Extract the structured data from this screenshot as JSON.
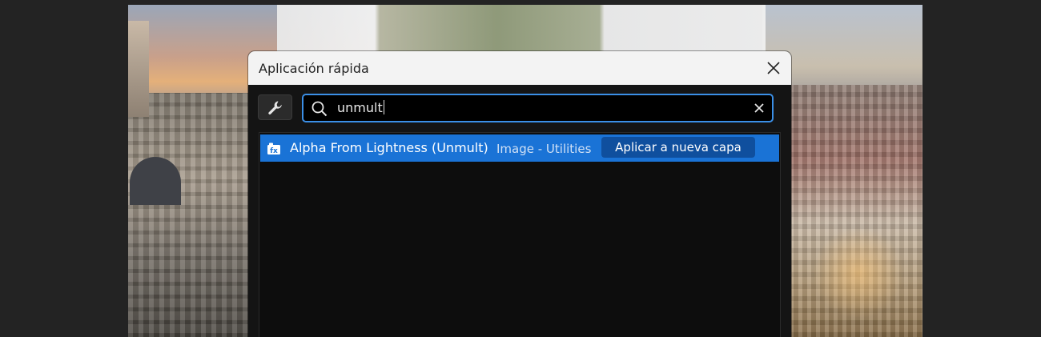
{
  "dialog": {
    "title": "Aplicación rápida"
  },
  "search": {
    "value": "unmult",
    "icon": "search-icon"
  },
  "results": [
    {
      "name": "Alpha From Lightness (Unmult)",
      "category": "Image - Utilities",
      "action": "Aplicar a nueva capa",
      "selected": true
    }
  ],
  "colors": {
    "selection": "#1a73d6",
    "focus_border": "#3b8fe6",
    "apply_button": "#0f4f9e"
  }
}
